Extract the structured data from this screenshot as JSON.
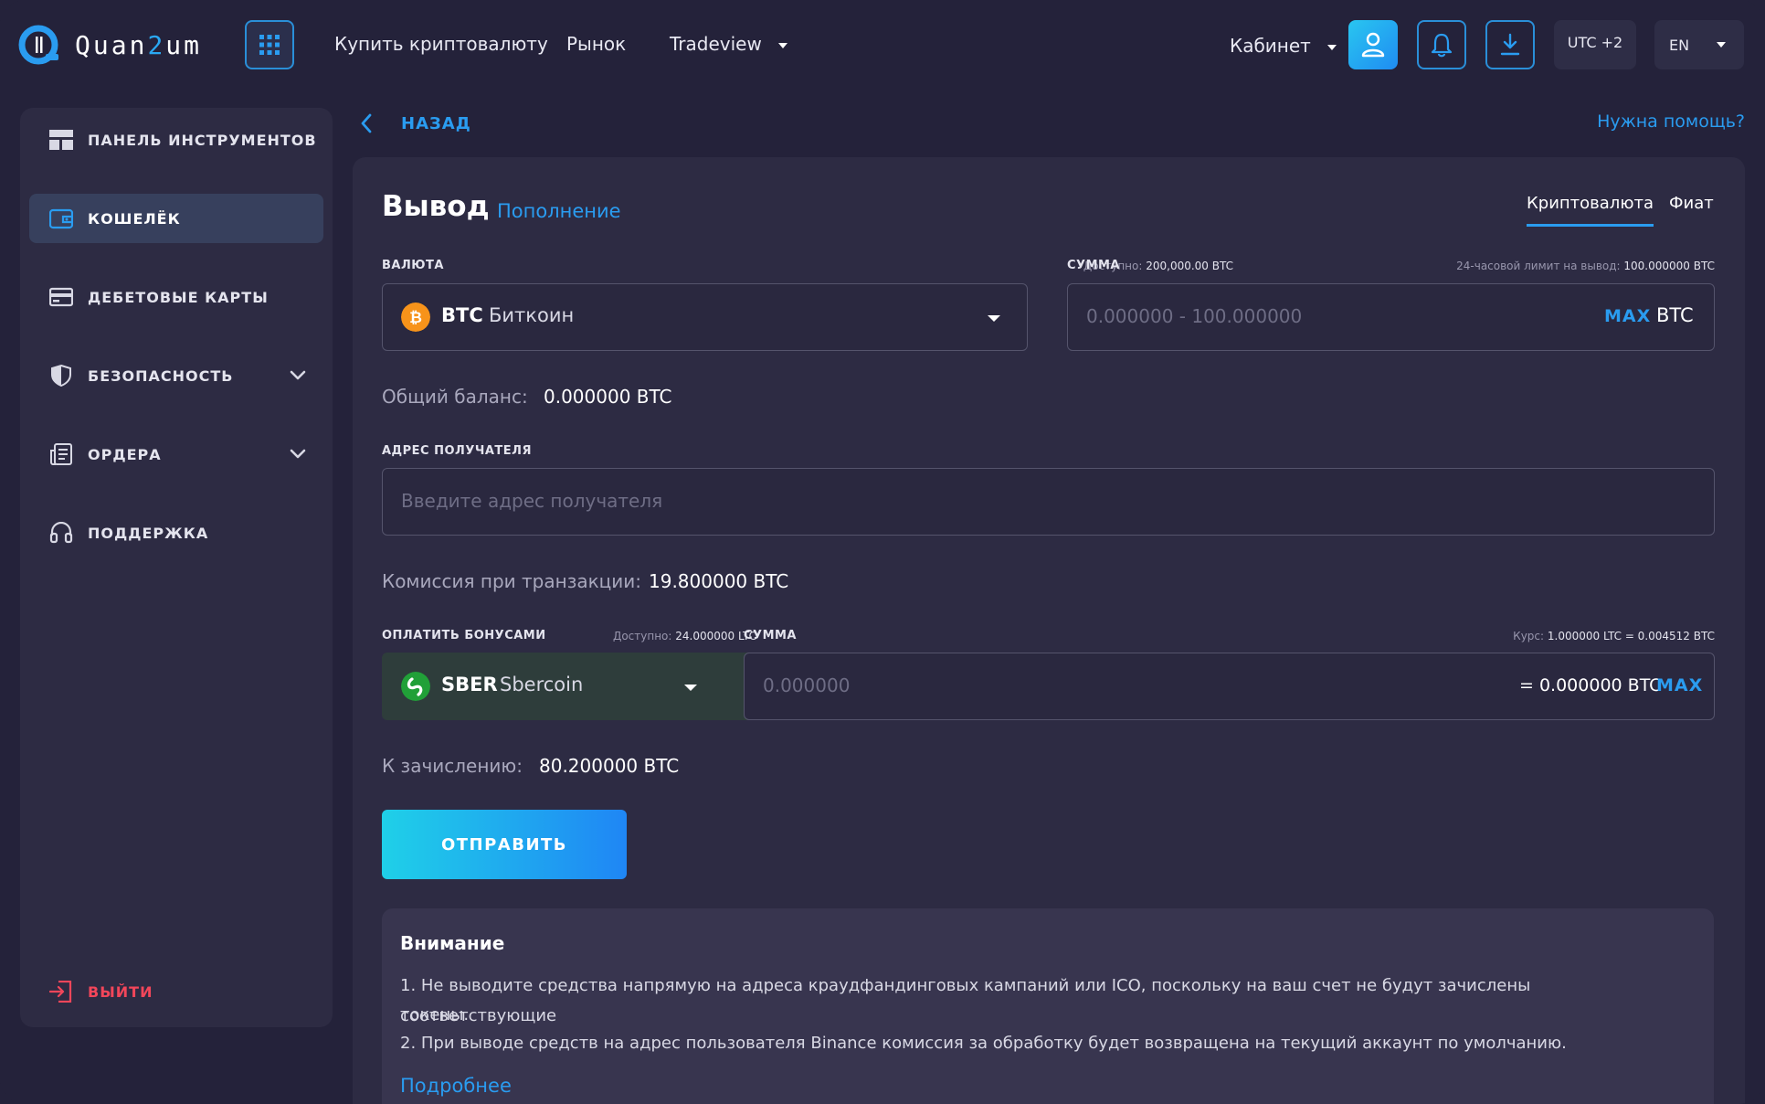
{
  "header": {
    "logo_text_a": "Quan",
    "logo_text_b": "2",
    "logo_text_c": "um",
    "nav": {
      "buy_crypto": "Купить криптовалюту",
      "market": "Рынок",
      "tradeview": "Tradeview"
    },
    "cabinet": "Кабинет",
    "timezone": "UTC +2",
    "language": "EN",
    "icons": [
      "grid-icon",
      "user-icon",
      "bell-icon",
      "download-icon"
    ]
  },
  "sidebar": {
    "items": [
      {
        "label": "ПАНЕЛЬ ИНСТРУМЕНТОВ",
        "icon": "dashboard-icon"
      },
      {
        "label": "КОШЕЛЁК",
        "icon": "wallet-icon",
        "active": true
      },
      {
        "label": "ДЕБЕТОВЫЕ КАРТЫ",
        "icon": "card-icon"
      },
      {
        "label": "БЕЗОПАСНОСТЬ",
        "icon": "shield-icon",
        "expandable": true
      },
      {
        "label": "ОРДЕРА",
        "icon": "orders-icon",
        "expandable": true
      },
      {
        "label": "ПОДДЕРЖКА",
        "icon": "headset-icon"
      }
    ],
    "logout": "ВЫЙТИ"
  },
  "top": {
    "back": "НАЗАД",
    "help": "Нужна помощь?"
  },
  "panel": {
    "title": "Вывод",
    "topup_link": "Пополнение",
    "tabs": {
      "crypto": "Криптовалюта",
      "fiat": "Фиат"
    },
    "currency": {
      "label": "ВАЛЮТА",
      "available_label": "Доступно:",
      "available_value": "200,000.00 BTC",
      "code": "BTC",
      "name": "Биткоин"
    },
    "amount": {
      "label": "СУММА",
      "limit_label": "24-часовой лимит на вывод:",
      "limit_value": "100.000000 BTC",
      "placeholder": "0.000000 - 100.000000",
      "max": "MAX",
      "unit": "BTC"
    },
    "total_balance": {
      "label": "Общий баланс:",
      "value": "0.000000 BTC"
    },
    "recipient": {
      "label": "АДРЕС ПОЛУЧАТЕЛЯ",
      "placeholder": "Введите адрес получателя"
    },
    "fee": {
      "label": "Комиссия при транзакции:",
      "value": "19.800000 BTC"
    },
    "bonus": {
      "label": "ОПЛАТИТЬ БОНУСАМИ",
      "available_label": "Доступно:",
      "available_value": "24.000000 LTC",
      "code": "SBER",
      "name": "Sbercoin"
    },
    "bonus_amount": {
      "label": "СУММА",
      "rate_label": "Курс:",
      "rate_value": "1.000000 LTC = 0.004512 BTC",
      "placeholder": "0.000000",
      "equiv": "= 0.000000 BTC",
      "max": "MAX"
    },
    "credit": {
      "label": "К зачислению:",
      "value": "80.200000 BTC"
    },
    "submit": "ОТПРАВИТЬ",
    "notice": {
      "title": "Внимание",
      "line1a": "1. Не выводите средства напрямую на адреса краудфандинговых кампаний или ICO, поскольку на ваш счет не будут зачислены соответствующие",
      "line1b": "токены.",
      "line2": "2. При выводе средств на адрес пользователя Binance комиссия за обработку будет возвращена на текущий аккаунт по умолчанию.",
      "more": "Подробнее"
    }
  },
  "colors": {
    "background": "#24223a",
    "panel": "#2d2b43",
    "accent": "#2a9cf0",
    "danger": "#f2465a",
    "btc": "#f7931a",
    "sber": "#21a038"
  }
}
